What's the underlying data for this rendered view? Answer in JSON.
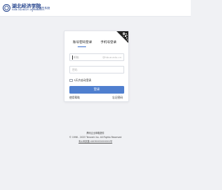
{
  "header": {
    "logo_name": "湖北经济学院",
    "logo_name_en": "HUBEI UNIVERSITY OF ECONOMICS",
    "subtitle": "企业邮件系统"
  },
  "login": {
    "tabs": [
      {
        "label": "账号密码登录",
        "active": true
      },
      {
        "label": "手机号登录",
        "active": false
      }
    ],
    "username": {
      "placeholder": "邮箱",
      "domain_suffix": "@hbue.edu.cn"
    },
    "password": {
      "placeholder": "密码"
    },
    "remember_label": "5天内自动登录",
    "remember_checked": false,
    "submit_label": "登录",
    "help_label": "使用帮助",
    "forgot_label": "忘记密码"
  },
  "footer": {
    "line1": "腾讯企业邮箱提供",
    "line2": "© 1998 - 2023 Tencent Inc. All Rights Reserved",
    "line3": "粤公网安备 44030002000001号"
  },
  "colors": {
    "accent": "#4f7fcf",
    "brand": "#1f3f8a",
    "background": "#f0f1f4"
  },
  "icons": {
    "qr_toggle": "qr-code-icon",
    "logo": "university-seal-icon"
  }
}
